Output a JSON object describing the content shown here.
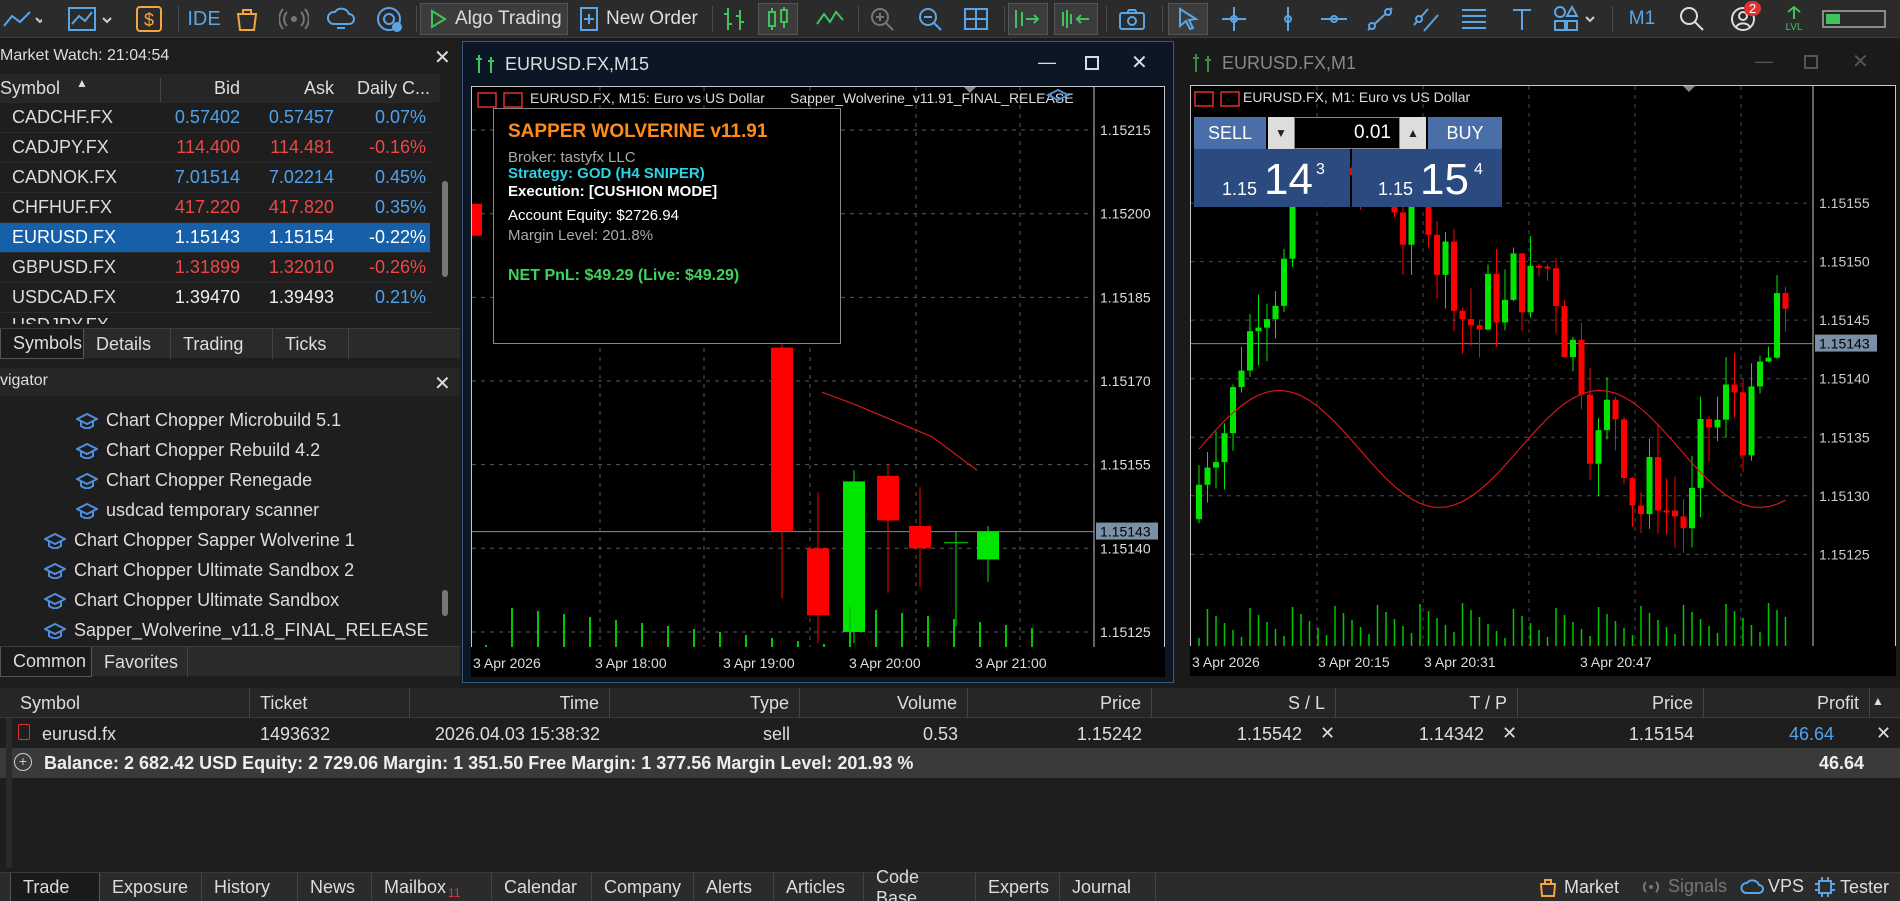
{
  "toolbar": {
    "algo_trading": "Algo Trading",
    "new_order": "New Order",
    "ide": "IDE",
    "timeframe": "M1",
    "notif_count": "2",
    "lvl": "LVL"
  },
  "market_watch": {
    "title": "Market Watch: 21:04:54",
    "columns": [
      "Symbol",
      "Bid",
      "Ask",
      "Daily C..."
    ],
    "rows": [
      {
        "symbol": "CADCHF.FX",
        "bid": "0.57402",
        "ask": "0.57457",
        "change": "0.07%",
        "color": "blue"
      },
      {
        "symbol": "CADJPY.FX",
        "bid": "114.400",
        "ask": "114.481",
        "change": "-0.16%",
        "color": "red"
      },
      {
        "symbol": "CADNOK.FX",
        "bid": "7.01514",
        "ask": "7.02214",
        "change": "0.45%",
        "color": "blue"
      },
      {
        "symbol": "CHFHUF.FX",
        "bid": "417.220",
        "ask": "417.820",
        "change": "0.35%",
        "color": "red"
      },
      {
        "symbol": "EURUSD.FX",
        "bid": "1.15143",
        "ask": "1.15154",
        "change": "-0.22%",
        "color": "sel"
      },
      {
        "symbol": "GBPUSD.FX",
        "bid": "1.31899",
        "ask": "1.32010",
        "change": "-0.26%",
        "color": "red"
      },
      {
        "symbol": "USDCAD.FX",
        "bid": "1.39470",
        "ask": "1.39493",
        "change": "0.21%",
        "color": "white"
      }
    ],
    "partial_row": "USDJPY.FX",
    "tabs": [
      "Symbols",
      "Details",
      "Trading",
      "Ticks"
    ]
  },
  "navigator": {
    "title": "Navigator",
    "items": [
      "Chart Chopper Microbuild 5.1",
      "Chart Chopper Rebuild 4.2",
      "Chart Chopper Renegade",
      "usdcad temporary scanner",
      "Chart Chopper Sapper Wolverine 1",
      "Chart Chopper Ultimate Sandbox 2",
      "Chart Chopper Ultimate Sandbox",
      "Sapper_Wolverine_v11.8_FINAL_RELEASE"
    ],
    "tabs": [
      "Common",
      "Favorites"
    ]
  },
  "chart1": {
    "title": "EURUSD.FX,M15",
    "header": "EURUSD.FX, M15:  Euro vs US Dollar",
    "ea_name": "Sapper_Wolverine_v11.91_FINAL_RELEASE",
    "price_labels": [
      "1.15215",
      "1.15200",
      "1.15185",
      "1.15170",
      "1.15155",
      "1.15140",
      "1.15125"
    ],
    "current_price": "1.15143",
    "time_labels": [
      "3 Apr 2026",
      "3 Apr 18:00",
      "3 Apr 19:00",
      "3 Apr 20:00",
      "3 Apr 21:00"
    ],
    "overlay": {
      "title": "SAPPER WOLVERINE v11.91",
      "broker": "Broker: tastyfx LLC",
      "strategy": "Strategy: GOD (H4 SNIPER)",
      "execution": "Execution: [CUSHION MODE]",
      "equity": "Account Equity: $2726.94",
      "margin": "Margin Level: 201.8%",
      "pnl": "NET PnL: $49.29 (Live: $49.29)"
    }
  },
  "chart2": {
    "title": "EURUSD.FX,M1",
    "header": "EURUSD.FX, M1:  Euro vs US Dollar",
    "price_labels": [
      "1.15155",
      "1.15150",
      "1.15145",
      "1.15140",
      "1.15135",
      "1.15130",
      "1.15125"
    ],
    "current_price": "1.15143",
    "time_labels": [
      "3 Apr 2026",
      "3 Apr 20:15",
      "3 Apr 20:31",
      "3 Apr 20:47"
    ],
    "one_click": {
      "sell": "SELL",
      "buy": "BUY",
      "volume": "0.01",
      "sell_big": "1.15",
      "sell_pips": "14",
      "sell_frac": "3",
      "buy_big": "1.15",
      "buy_pips": "15",
      "buy_frac": "4"
    }
  },
  "terminal": {
    "columns": [
      "Symbol",
      "Ticket",
      "Time",
      "Type",
      "Volume",
      "Price",
      "S / L",
      "T / P",
      "Price",
      "Profit"
    ],
    "row": {
      "symbol": "eurusd.fx",
      "ticket": "1493632",
      "time": "2026.04.03 15:38:32",
      "type": "sell",
      "volume": "0.53",
      "price": "1.15242",
      "sl": "1.15542",
      "tp": "1.14342",
      "cur_price": "1.15154",
      "profit": "46.64"
    },
    "balance": "Balance: 2 682.42 USD  Equity: 2 729.06  Margin: 1 351.50  Free Margin: 1 377.56  Margin Level: 201.93 %",
    "balance_profit": "46.64",
    "tabs": [
      "Trade",
      "Exposure",
      "History",
      "News",
      "Mailbox",
      "Calendar",
      "Company",
      "Alerts",
      "Articles",
      "Code Base",
      "Experts",
      "Journal"
    ],
    "mailbox_badge": "11",
    "right_items": [
      "Market",
      "Signals",
      "VPS",
      "Tester"
    ]
  }
}
